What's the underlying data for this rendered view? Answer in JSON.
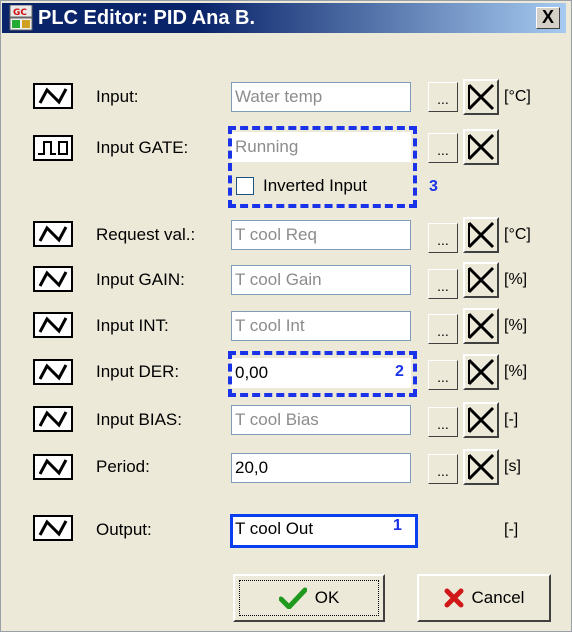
{
  "window": {
    "title": "PLC Editor: PID Ana B.",
    "close_label": "X",
    "app_icon_text": "GC"
  },
  "rows": [
    {
      "icon": "analog-signal-icon",
      "label": "Input:",
      "value": "Water temp",
      "unit": "[°C]",
      "value_style": "gray"
    },
    {
      "icon": "digital-signal-icon",
      "label": "Input GATE:",
      "value": "Running",
      "unit": "",
      "value_style": "gray"
    },
    {
      "icon": "analog-signal-icon",
      "label": "Request val.:",
      "value": "T cool Req",
      "unit": "[°C]",
      "value_style": "gray"
    },
    {
      "icon": "analog-signal-icon",
      "label": "Input GAIN:",
      "value": "T cool Gain",
      "unit": "[%]",
      "value_style": "gray"
    },
    {
      "icon": "analog-signal-icon",
      "label": "Input INT:",
      "value": "T cool Int",
      "unit": "[%]",
      "value_style": "gray"
    },
    {
      "icon": "analog-signal-icon",
      "label": "Input DER:",
      "value": "0,00",
      "unit": "[%]",
      "value_style": "normal"
    },
    {
      "icon": "analog-signal-icon",
      "label": "Input BIAS:",
      "value": "T cool Bias",
      "unit": "[-]",
      "value_style": "gray"
    },
    {
      "icon": "analog-signal-icon",
      "label": "Period:",
      "value": "20,0",
      "unit": "[s]",
      "value_style": "normal"
    },
    {
      "icon": "analog-signal-icon",
      "label": "Output:",
      "value": "T cool Out",
      "unit": "[-]",
      "value_style": "selected"
    }
  ],
  "browse_label": "...",
  "checkbox": {
    "label": "Inverted Input",
    "checked": false
  },
  "markers": {
    "one": "1",
    "two": "2",
    "three": "3"
  },
  "buttons": {
    "ok": "OK",
    "cancel": "Cancel"
  },
  "colors": {
    "title_gradient_start": "#0a246a",
    "selection_blue": "#1a33e8",
    "dialog_bg": "#ece9d8"
  }
}
